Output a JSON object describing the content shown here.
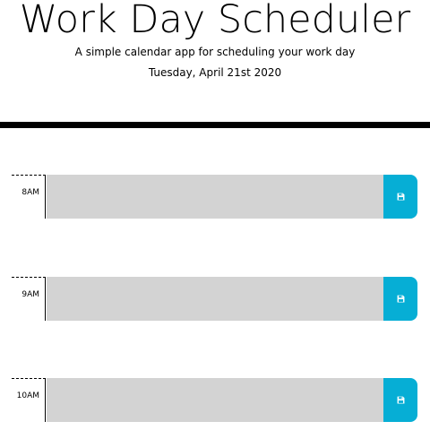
{
  "header": {
    "title": "Work Day Scheduler",
    "lead": "A simple calendar app for scheduling your work day",
    "current_day": "Tuesday, April 21st 2020"
  },
  "colors": {
    "background": "#ffffff",
    "divider": "#000000",
    "textarea": "#d3d3d3",
    "save_button": "#06aed5",
    "save_icon": "#ffffff"
  },
  "time_blocks": [
    {
      "hour": "8AM",
      "description": "",
      "save_icon": "floppy-disk-icon"
    },
    {
      "hour": "9AM",
      "description": "",
      "save_icon": "floppy-disk-icon"
    },
    {
      "hour": "10AM",
      "description": "",
      "save_icon": "floppy-disk-icon"
    }
  ]
}
